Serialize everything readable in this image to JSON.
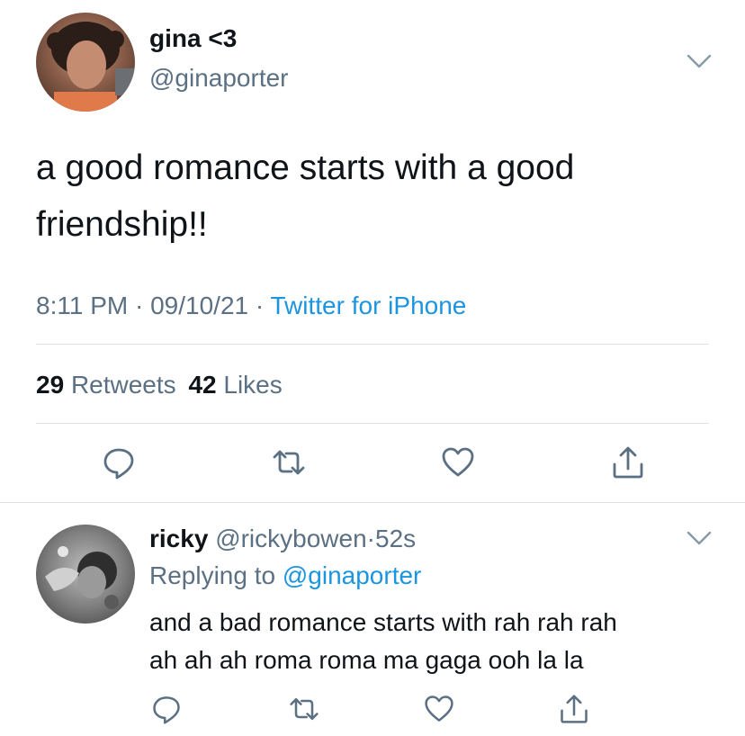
{
  "main_tweet": {
    "display_name": "gina <3",
    "handle": "@ginaporter",
    "text_line1": "a good romance starts with a good",
    "text_line2": "friendship!!",
    "time": "8:11 PM",
    "sep1": "·",
    "date": "09/10/21",
    "sep2": "·",
    "source": "Twitter for iPhone",
    "retweets_count": "29",
    "retweets_label": "Retweets",
    "likes_count": "42",
    "likes_label": "Likes",
    "avatar_icon": "avatar-photo-icon"
  },
  "reply": {
    "display_name": "ricky",
    "handle": "@rickybowen",
    "sep": "·",
    "age": "52s",
    "replying_prefix": "Replying to",
    "replying_handle": "@ginaporter",
    "text_line1": "and a bad romance starts with rah rah rah",
    "text_line2": "ah ah ah roma roma ma gaga ooh la la",
    "avatar_icon": "avatar-photo-icon"
  },
  "icons": {
    "reply": "reply-icon",
    "retweet": "retweet-icon",
    "like": "heart-icon",
    "share": "share-icon",
    "more": "chevron-down-icon"
  },
  "colors": {
    "text": "#0f1419",
    "muted": "#5b7083",
    "link": "#1b95e0",
    "divider": "#dfe3e7"
  }
}
